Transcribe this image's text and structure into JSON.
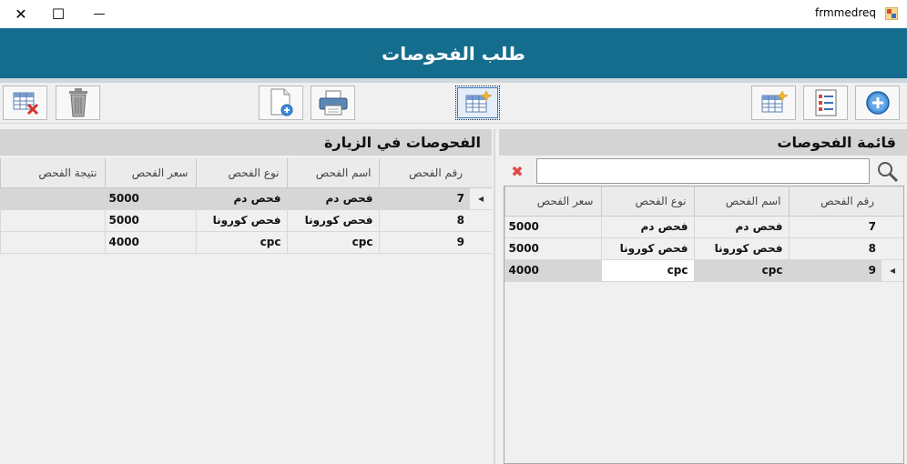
{
  "window": {
    "title": "frmmedreq",
    "minimize_glyph": "—",
    "maximize_glyph": "☐",
    "close_glyph": "✕"
  },
  "header": {
    "title": "طلب الفحوصات"
  },
  "toolbar": {
    "icons": [
      "table-delete-icon",
      "trash-icon",
      "new-document-icon",
      "print-icon",
      "table-new-icon",
      "table-new-icon",
      "list-icon",
      "add-circle-icon"
    ]
  },
  "visit_panel": {
    "title": "الفحوصات في الزيارة",
    "columns": [
      "رقم الفحص",
      "اسم الفحص",
      "نوع الفحص",
      "سعر الفحص",
      "نتيجة الفحص"
    ],
    "rows": [
      {
        "id": "7",
        "name": "فحص دم",
        "type": "فحص دم",
        "price": "5000",
        "result": ""
      },
      {
        "id": "8",
        "name": "فحص كورونا",
        "type": "فحص كورونا",
        "price": "5000",
        "result": ""
      },
      {
        "id": "9",
        "name": "cpc",
        "type": "cpc",
        "price": "4000",
        "result": ""
      }
    ],
    "current_row_marker": "◂"
  },
  "list_panel": {
    "title": "قائمة الفحوصات",
    "search_value": "",
    "clear_glyph": "✖",
    "columns": [
      "رقم الفحص",
      "اسم الفحص",
      "نوع الفحص",
      "سعر الفحص"
    ],
    "rows": [
      {
        "id": "7",
        "name": "فحص دم",
        "type": "فحص دم",
        "price": "5000"
      },
      {
        "id": "8",
        "name": "فحص كورونا",
        "type": "فحص كورونا",
        "price": "5000"
      },
      {
        "id": "9",
        "name": "cpc",
        "type": "cpc",
        "price": "4000"
      }
    ],
    "current_row_marker": "◂"
  },
  "colors": {
    "header_bg": "#156d8e",
    "clear_icon": "#e04848"
  }
}
